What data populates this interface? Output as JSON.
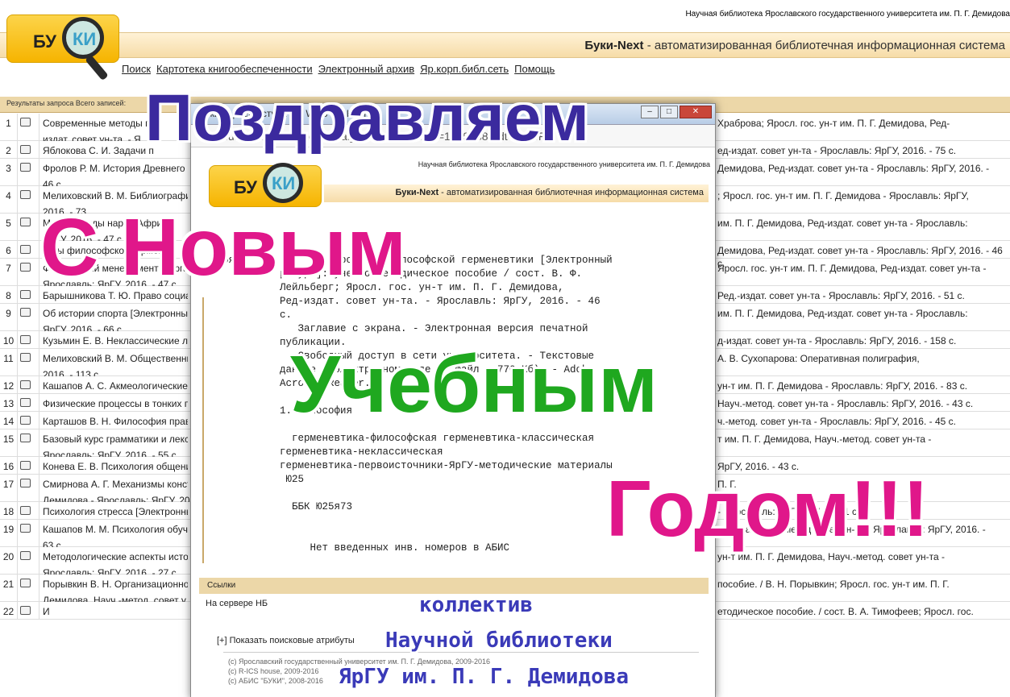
{
  "site": {
    "top_note": "Научная библиотека Ярославского государственного университета им. П. Г. Демидова",
    "logo_text_left": "БУ",
    "logo_text_right": "КИ",
    "system_name": "Буки-Next",
    "system_desc": " - автоматизированная библиотечная информационная система"
  },
  "nav": [
    {
      "label": "Поиск"
    },
    {
      "label": "Картотека книгообеспеченности"
    },
    {
      "label": "Электронный архив"
    },
    {
      "label": "Яр.корп.библ.сеть"
    },
    {
      "label": "Помощь"
    }
  ],
  "results_bar": "Результаты запроса     Всего записей:",
  "rows": [
    {
      "n": "1",
      "text": "Современные методы пр",
      "right": "Храброва; Яросл. гос. ун-т им. П. Г. Демидова, Ред-",
      "text2": "издат. совет ун-та. - Я"
    },
    {
      "n": "2",
      "text": "Яблокова С. И. Задачи п",
      "right": "ед-издат. совет ун-та - Ярославль: ЯрГУ, 2016. - 75 с."
    },
    {
      "n": "3",
      "text": "Фролов Р. М. История Древнего",
      "right": "Демидова, Ред-издат. совет ун-та - Ярославль: ЯрГУ, 2016. -",
      "text2": "46 с."
    },
    {
      "n": "4",
      "text": "Мелиховский В. М. Библиографи",
      "right": "; Яросл. гос. ун-т им. П. Г. Демидова - Ярославль: ЯрГУ,",
      "text2": "2016. - 73"
    },
    {
      "n": "5",
      "text": "Ми    и легенды народ   Афри",
      "right": "им. П. Г. Демидова, Ред-издат. совет ун-та - Ярославль:",
      "text2": "ЯрГУ, 2016. - 47 с."
    },
    {
      "n": "6",
      "text": "Во   ы философской герменев",
      "right": "Демидова, Ред-издат. совет ун-та - Ярославль: ЯрГУ, 2016. - 46 с."
    },
    {
      "n": "7",
      "text": "Финансовый менеджмент в орга",
      "right": "Яросл. гос. ун-т им. П. Г. Демидова, Ред-издат. совет ун-та -",
      "text2": "Ярославль: ЯрГУ, 2016. - 47 с."
    },
    {
      "n": "8",
      "text": "Барышникова Т. Ю. Право социа",
      "right": "Ред.-издат. совет ун-та - Ярославль: ЯрГУ, 2016. - 51 с."
    },
    {
      "n": "9",
      "text": "Об истории спорта [Электронны",
      "right": "им. П. Г. Демидова, Ред-издат. совет ун-та - Ярославль:",
      "text2": "ЯрГУ, 2016. - 66 с."
    },
    {
      "n": "10",
      "text": "Кузьмин Е. В. Неклассические ло",
      "right": "д-издат. совет ун-та - Ярославль: ЯрГУ, 2016. - 158 с."
    },
    {
      "n": "11",
      "text": "Мелиховский В. М. Общественны",
      "right": "А. В. Сухопарова: Оперативная полиграфия,",
      "text2": "2016. - 113 с."
    },
    {
      "n": "12",
      "text": "Кашапов А. С. Акмеологические",
      "right": "ун-т им. П. Г. Демидова - Ярославль: ЯрГУ, 2016. - 83 с."
    },
    {
      "n": "13",
      "text": "Физические процессы в тонких п",
      "right": "Науч.-метод. совет ун-та - Ярославль: ЯрГУ, 2016. - 43 с."
    },
    {
      "n": "14",
      "text": "Карташов В. Н. Философия прав",
      "right": "ч.-метод. совет ун-та - Ярославль: ЯрГУ, 2016. - 45 с."
    },
    {
      "n": "15",
      "text": "Базовый курс грамматики и лекс",
      "right": "т им. П. Г. Демидова, Науч.-метод. совет ун-та -",
      "text2": "Ярославль: ЯрГУ, 2016. - 55 с."
    },
    {
      "n": "16",
      "text": "Конева Е. В. Психология общени",
      "right": "ЯрГУ, 2016. - 43 с."
    },
    {
      "n": "17",
      "text": "Смирнова А. Г. Механизмы конст",
      "right": "П. Г.",
      "text2": "Демидова - Ярославль: ЯрГУ, 20"
    },
    {
      "n": "18",
      "text": "Психология стресса [Электронны",
      "right": "- Ярославль: ЯрГУ, 2016. - 71 с."
    },
    {
      "n": "19",
      "text": "Кашапов М. М. Психология обуч",
      "right": "мидова, Науч.-метод совет ун-та - Ярославль: ЯрГУ, 2016. -",
      "text2": "63 с."
    },
    {
      "n": "20",
      "text": "Методологические аспекты исто",
      "right": "ун-т им. П. Г. Демидова, Науч.-метод. совет ун-та -",
      "text2": "Ярославль: ЯрГУ, 2016. - 27 с."
    },
    {
      "n": "21",
      "text": "Порывкин В. Н. Организационно",
      "right": "пособие. / В. Н. Порывкин; Яросл. гос. ун-т им. П. Г.",
      "text2": "Демидова, Науч.-метод. совет у"
    },
    {
      "n": "22",
      "text": "И",
      "right": "етодическое пособие. / сост. В. А. Тимофеев; Яросл. гос."
    }
  ],
  "window": {
    "title": "Буки-N      рвер     оступа          огу      WEB - G    le Ch   e",
    "url": "lib.uniyar.ac.ru/opac/bk_cat_card.php?rec_id=1799888&idt=YAr4F8",
    "win_min": "–",
    "win_max": "□",
    "win_close": "✕",
    "inner_note": "Научная библиотека Ярославского государственного университета им. П. Г. Демидова",
    "inner_system_name": "Буки-Next",
    "inner_system_desc": " - автоматизированная библиотечная информационная система",
    "record_left": "Ю25я73\n4",
    "record_text": "         Проблемы философской герменевтики [Электронный\nресурс]: учебно-методическое пособие / сост. В. Ф.\nЛейльберг; Яросл. гос. ун-т им. П. Г. Демидова,\nРед-издат. совет ун-та. - Ярославль: ЯрГУ, 2016. - 46\nс.\n   Заглавие с экрана. - Электронная версия печатной\nпубликации.\n   Свободный доступ в сети университета. - Текстовые\nданные в электронном виде (1 файл : 770 Кб). - Adobe\nAcrobat Reader.\n\n1. Философия\n\n  герменевтика-философская герменевтика-классическая\nгерменевтика-неклассическая\nгерменевтика-первоисточники-ЯрГУ-методические материалы\n Ю25\n\n  ББК Ю25я73\n\n\n     Нет введенных инв. номеров в АБИС",
    "links_bar": "Ссылки",
    "server": "На сервере НБ",
    "show_attr": "[+] Показать поисковые атрибуты",
    "copyright": [
      "(c) Ярославский государственный университет им. П. Г. Демидова, 2009-2016",
      "(c) R-ICS house, 2009-2016",
      "(c) АБИС \"БУКИ\", 2008-2016"
    ]
  },
  "greeting": {
    "line1": "Поздравляем",
    "line2": "С Новым",
    "line3": "Учебным",
    "line4": "Годом!!!",
    "sig1": "коллектив",
    "sig2": "Научной библиотеки",
    "sig3": "ЯрГУ им. П. Г. Демидова",
    "colors": {
      "line1": "#3b2a9e",
      "line2": "#e0178a",
      "line3": "#1fa81f",
      "line4": "#e0178a",
      "sig": "#3a3ab8"
    }
  }
}
